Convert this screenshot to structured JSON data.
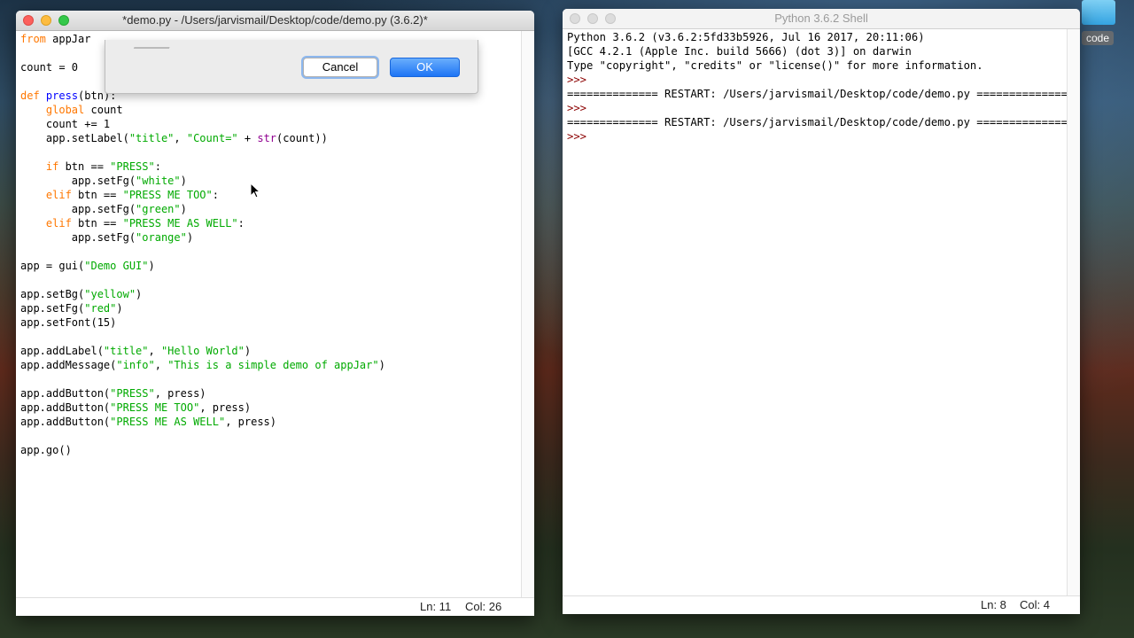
{
  "desktop": {
    "folder_label": "code"
  },
  "editor": {
    "title": "*demo.py - /Users/jarvismail/Desktop/code/demo.py (3.6.2)*",
    "status_line": "Ln: 11",
    "status_col": "Col: 26",
    "lines": [
      {
        "segs": [
          {
            "t": "from",
            "c": "kw"
          },
          {
            "t": " appJar"
          }
        ]
      },
      {
        "segs": [
          {
            "t": ""
          }
        ]
      },
      {
        "segs": [
          {
            "t": "count = 0"
          }
        ]
      },
      {
        "segs": [
          {
            "t": ""
          }
        ]
      },
      {
        "segs": [
          {
            "t": "def",
            "c": "kw"
          },
          {
            "t": " "
          },
          {
            "t": "press",
            "c": "fn"
          },
          {
            "t": "(btn):"
          }
        ]
      },
      {
        "segs": [
          {
            "t": "    "
          },
          {
            "t": "global",
            "c": "kw"
          },
          {
            "t": " count"
          }
        ]
      },
      {
        "segs": [
          {
            "t": "    count += 1"
          }
        ]
      },
      {
        "segs": [
          {
            "t": "    app.setLabel("
          },
          {
            "t": "\"title\"",
            "c": "str"
          },
          {
            "t": ", "
          },
          {
            "t": "\"Count=\"",
            "c": "str"
          },
          {
            "t": " + "
          },
          {
            "t": "str",
            "c": "bi"
          },
          {
            "t": "(count))"
          }
        ]
      },
      {
        "segs": [
          {
            "t": ""
          }
        ]
      },
      {
        "segs": [
          {
            "t": "    "
          },
          {
            "t": "if",
            "c": "kw"
          },
          {
            "t": " btn == "
          },
          {
            "t": "\"PRESS\"",
            "c": "str"
          },
          {
            "t": ":"
          }
        ]
      },
      {
        "segs": [
          {
            "t": "        app.setFg("
          },
          {
            "t": "\"white\"",
            "c": "str"
          },
          {
            "t": ")"
          }
        ]
      },
      {
        "segs": [
          {
            "t": "    "
          },
          {
            "t": "elif",
            "c": "kw"
          },
          {
            "t": " btn == "
          },
          {
            "t": "\"PRESS ME TOO\"",
            "c": "str"
          },
          {
            "t": ":"
          }
        ]
      },
      {
        "segs": [
          {
            "t": "        app.setFg("
          },
          {
            "t": "\"green\"",
            "c": "str"
          },
          {
            "t": ")"
          }
        ]
      },
      {
        "segs": [
          {
            "t": "    "
          },
          {
            "t": "elif",
            "c": "kw"
          },
          {
            "t": " btn == "
          },
          {
            "t": "\"PRESS ME AS WELL\"",
            "c": "str"
          },
          {
            "t": ":"
          }
        ]
      },
      {
        "segs": [
          {
            "t": "        app.setFg("
          },
          {
            "t": "\"orange\"",
            "c": "str"
          },
          {
            "t": ")"
          }
        ]
      },
      {
        "segs": [
          {
            "t": ""
          }
        ]
      },
      {
        "segs": [
          {
            "t": "app = gui("
          },
          {
            "t": "\"Demo GUI\"",
            "c": "str"
          },
          {
            "t": ")"
          }
        ]
      },
      {
        "segs": [
          {
            "t": ""
          }
        ]
      },
      {
        "segs": [
          {
            "t": "app.setBg("
          },
          {
            "t": "\"yellow\"",
            "c": "str"
          },
          {
            "t": ")"
          }
        ]
      },
      {
        "segs": [
          {
            "t": "app.setFg("
          },
          {
            "t": "\"red\"",
            "c": "str"
          },
          {
            "t": ")"
          }
        ]
      },
      {
        "segs": [
          {
            "t": "app.setFont(15)"
          }
        ]
      },
      {
        "segs": [
          {
            "t": ""
          }
        ]
      },
      {
        "segs": [
          {
            "t": "app.addLabel("
          },
          {
            "t": "\"title\"",
            "c": "str"
          },
          {
            "t": ", "
          },
          {
            "t": "\"Hello World\"",
            "c": "str"
          },
          {
            "t": ")"
          }
        ]
      },
      {
        "segs": [
          {
            "t": "app.addMessage("
          },
          {
            "t": "\"info\"",
            "c": "str"
          },
          {
            "t": ", "
          },
          {
            "t": "\"This is a simple demo of appJar\"",
            "c": "str"
          },
          {
            "t": ")"
          }
        ]
      },
      {
        "segs": [
          {
            "t": ""
          }
        ]
      },
      {
        "segs": [
          {
            "t": "app.addButton("
          },
          {
            "t": "\"PRESS\"",
            "c": "str"
          },
          {
            "t": ", press)"
          }
        ]
      },
      {
        "segs": [
          {
            "t": "app.addButton("
          },
          {
            "t": "\"PRESS ME TOO\"",
            "c": "str"
          },
          {
            "t": ", press)"
          }
        ]
      },
      {
        "segs": [
          {
            "t": "app.addButton("
          },
          {
            "t": "\"PRESS ME AS WELL\"",
            "c": "str"
          },
          {
            "t": ", press)"
          }
        ]
      },
      {
        "segs": [
          {
            "t": ""
          }
        ]
      },
      {
        "segs": [
          {
            "t": "app.go()"
          }
        ]
      }
    ]
  },
  "dialog": {
    "cancel_label": "Cancel",
    "ok_label": "OK"
  },
  "shell": {
    "title": "Python 3.6.2 Shell",
    "status_line": "Ln: 8",
    "status_col": "Col: 4",
    "lines": [
      {
        "segs": [
          {
            "t": "Python 3.6.2 (v3.6.2:5fd33b5926, Jul 16 2017, 20:11:06)"
          }
        ]
      },
      {
        "segs": [
          {
            "t": "[GCC 4.2.1 (Apple Inc. build 5666) (dot 3)] on darwin"
          }
        ]
      },
      {
        "segs": [
          {
            "t": "Type \"copyright\", \"credits\" or \"license()\" for more information."
          }
        ]
      },
      {
        "segs": [
          {
            "t": ">>> ",
            "c": "prompt"
          }
        ]
      },
      {
        "segs": [
          {
            "t": "============== RESTART: /Users/jarvismail/Desktop/code/demo.py =============="
          }
        ]
      },
      {
        "segs": [
          {
            "t": ">>> ",
            "c": "prompt"
          }
        ]
      },
      {
        "segs": [
          {
            "t": "============== RESTART: /Users/jarvismail/Desktop/code/demo.py =============="
          }
        ]
      },
      {
        "segs": [
          {
            "t": ">>> ",
            "c": "prompt"
          }
        ]
      }
    ]
  }
}
